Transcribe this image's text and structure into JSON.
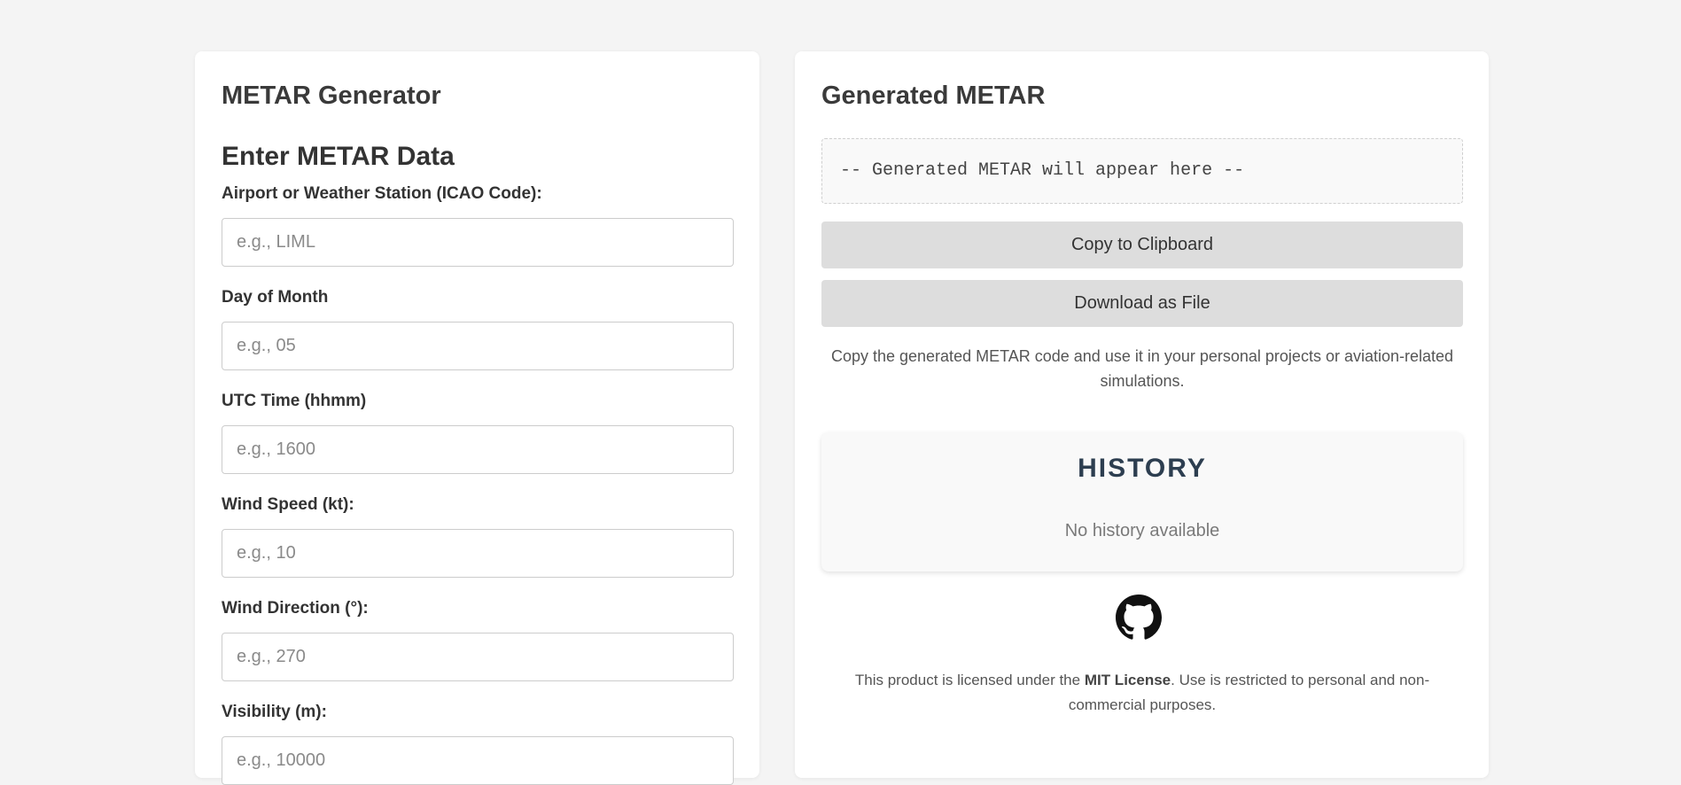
{
  "form": {
    "app_title": "METAR Generator",
    "section_title": "Enter METAR Data",
    "fields": [
      {
        "label": "Airport or Weather Station (ICAO Code):",
        "placeholder": "e.g., LIML",
        "value": ""
      },
      {
        "label": "Day of Month",
        "placeholder": "e.g., 05",
        "value": ""
      },
      {
        "label": "UTC Time (hhmm)",
        "placeholder": "e.g., 1600",
        "value": ""
      },
      {
        "label": "Wind Speed (kt):",
        "placeholder": "e.g., 10",
        "value": ""
      },
      {
        "label": "Wind Direction (°):",
        "placeholder": "e.g., 270",
        "value": ""
      },
      {
        "label": "Visibility (m):",
        "placeholder": "e.g., 10000",
        "value": ""
      }
    ]
  },
  "output": {
    "title": "Generated METAR",
    "placeholder_text": "-- Generated METAR will appear here --",
    "copy_button_label": "Copy to Clipboard",
    "download_button_label": "Download as File",
    "help_text": "Copy the generated METAR code and use it in your personal projects or aviation-related simulations."
  },
  "history": {
    "title": "HISTORY",
    "empty_text": "No history available"
  },
  "footer": {
    "github_icon": "github-icon",
    "license_prefix": "This product is licensed under the ",
    "license_name": "MIT License",
    "license_suffix": ". Use is restricted to personal and non-commercial purposes."
  },
  "colors": {
    "page_background": "#f4f4f4",
    "card_background": "#ffffff",
    "button_background": "#dddddd",
    "history_title": "#2d3e50"
  }
}
